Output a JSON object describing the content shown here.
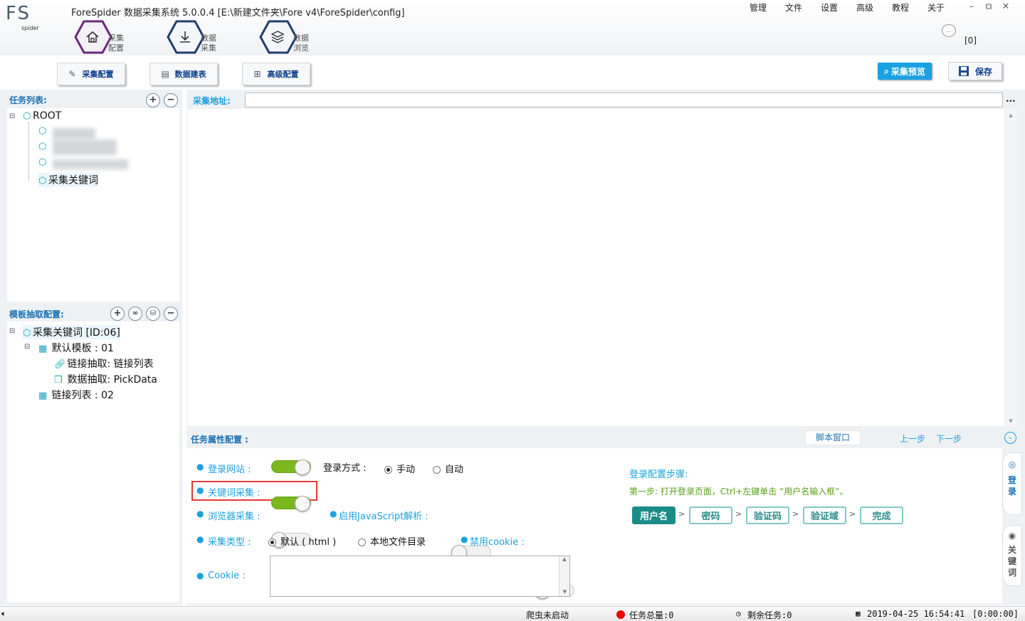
{
  "app": {
    "logo_main": "FS",
    "logo_sub": "spider",
    "title": "ForeSpider 数据采集系统  5.0.0.4  [E:\\新建文件夹\\Fore v4\\ForeSpider\\config]"
  },
  "menu": [
    "管理",
    "文件",
    "设置",
    "高级",
    "教程",
    "关于"
  ],
  "window_controls": {
    "minimize": "–",
    "restore": "⧉",
    "close": "✕"
  },
  "nav": [
    {
      "line1": "采集",
      "line2": "配置",
      "icon": "home-icon"
    },
    {
      "line1": "数据",
      "line2": "采集",
      "icon": "download-icon"
    },
    {
      "line1": "数据",
      "line2": "浏览",
      "icon": "layers-icon"
    }
  ],
  "header_right": {
    "bracket": "[0]",
    "chat_icon": "chat-icon"
  },
  "toolbar": {
    "collect_config": "采集配置",
    "data_table": "数据建表",
    "advanced": "高级配置",
    "preview": "采集预览",
    "save": "保存"
  },
  "task_list": {
    "title": "任务列表:",
    "add": "+",
    "remove": "−",
    "root": "ROOT",
    "items": [
      "采集关键词"
    ]
  },
  "template": {
    "title": "模板抽取配置:",
    "root": "采集关键词 [ID:06]",
    "nodes": [
      {
        "label": "默认模板 : 01"
      },
      {
        "label": "链接抽取: 链接列表"
      },
      {
        "label": "数据抽取: PickData"
      },
      {
        "label": "链接列表 : 02"
      }
    ]
  },
  "url": {
    "label": "采集地址:",
    "value": "",
    "more": "..."
  },
  "props": {
    "title": "任务属性配置 :",
    "script_window": "脚本窗口",
    "prev": "上一步",
    "next": "下一步",
    "login_site": "登录网站 :",
    "login_method": "登录方式 :",
    "manual": "手动",
    "auto": "自动",
    "keyword_collect": "关键词采集 :",
    "browser_collect": "浏览器采集 :",
    "enable_js": "启用JavaScript解析 :",
    "collect_type": "采集类型 :",
    "default_html": "默认 ( html )",
    "local_dir": "本地文件目录",
    "disable_cookie": "禁用cookie :",
    "cookie": "Cookie :",
    "cookie_value": "",
    "toggles": {
      "login_site": true,
      "keyword_collect": true,
      "browser_collect": false,
      "enable_js": false,
      "disable_cookie": false
    }
  },
  "login_steps": {
    "title": "登录配置步骤:",
    "hint": "第一步: 打开登录页面，Ctrl+左键单击 “用户名输入框”。",
    "steps": [
      "用户名",
      "密码",
      "验证码",
      "验证域",
      "完成"
    ]
  },
  "side_tabs": {
    "login": "登录",
    "keyword": "关键词"
  },
  "status": {
    "spider": "爬虫未启动",
    "total": "任务总量:0",
    "remaining": "剩余任务:0",
    "datetime": "2019-04-25 16:54:41",
    "elapsed": "[0:00:00]"
  },
  "colors": {
    "accent": "#1ba1e2",
    "title_blue": "#1b6fb3",
    "toggle_on": "#7ab81e",
    "step_teal": "#1c8c88",
    "highlight": "#e53935"
  }
}
